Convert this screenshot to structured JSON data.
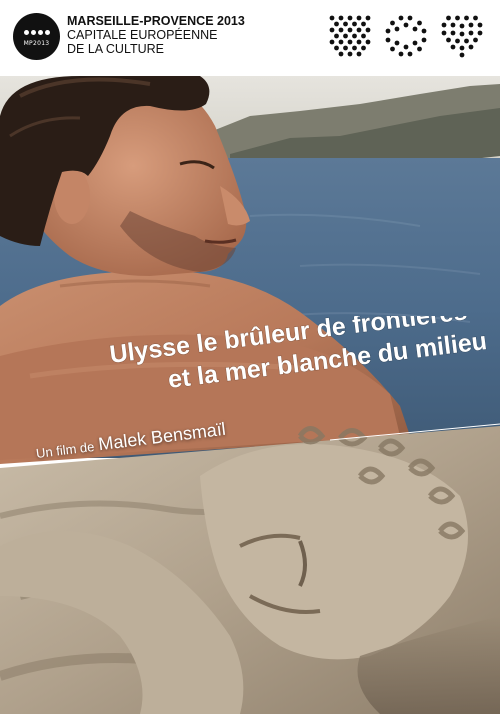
{
  "header": {
    "logo_text": "MP2013",
    "line1": "MARSEILLE-PROVENCE 2013",
    "line2": "CAPITALE EUROPÉENNE",
    "line3": "DE LA CULTURE"
  },
  "poster": {
    "title_line1": "Ulysse le brûleur de frontières",
    "title_line2": "et la mer blanche du milieu",
    "credit_prefix": "Un film de",
    "director": "Malek Bensmaïl"
  },
  "colors": {
    "text_white": "#ffffff",
    "header_black": "#111111",
    "sea_blue": "#4f6f8e",
    "stone": "#b3a592"
  }
}
